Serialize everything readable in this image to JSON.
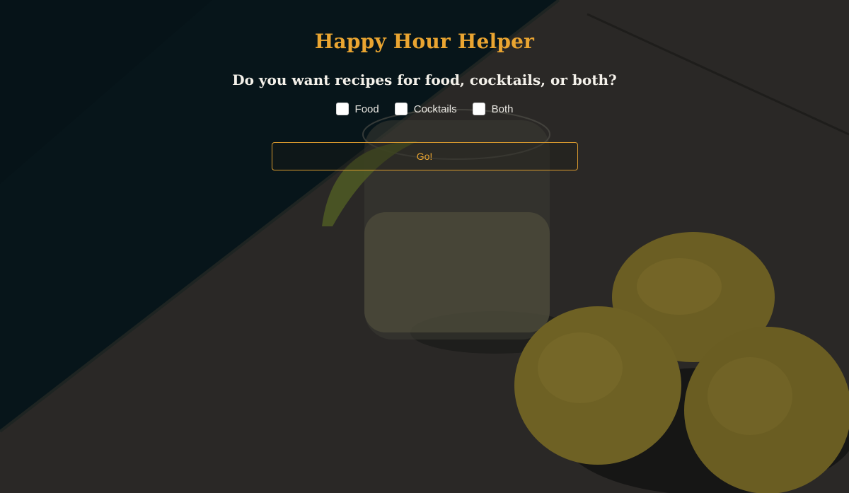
{
  "app": {
    "title": "Happy Hour Helper"
  },
  "form": {
    "question": "Do you want recipes for food, cocktails, or both?",
    "options": [
      {
        "label": "Food",
        "checked": false
      },
      {
        "label": "Cocktails",
        "checked": false
      },
      {
        "label": "Both",
        "checked": false
      }
    ],
    "submit_label": "Go!"
  },
  "colors": {
    "accent": "#eaa531",
    "heading_text": "#f4f1ea",
    "checkbox_bg": "#ffffff"
  }
}
